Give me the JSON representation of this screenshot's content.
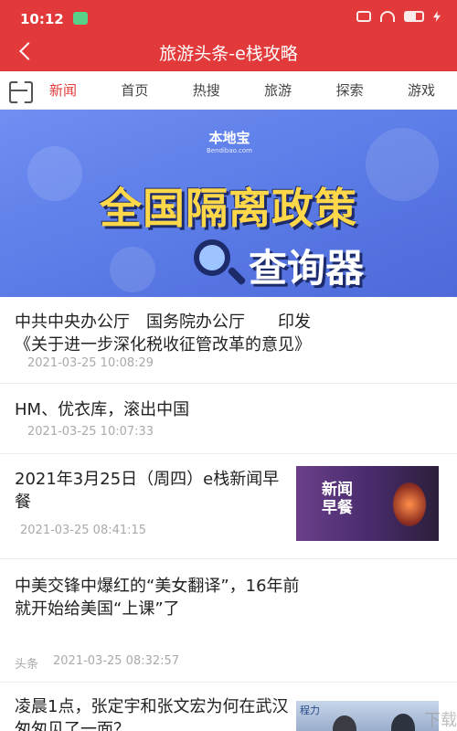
{
  "status_bar": {
    "time": "10:12"
  },
  "header": {
    "title": "旅游头条-e栈攻略"
  },
  "tabs": [
    {
      "label": "新闻",
      "active": true
    },
    {
      "label": "首页",
      "active": false
    },
    {
      "label": "热搜",
      "active": false
    },
    {
      "label": "旅游",
      "active": false
    },
    {
      "label": "探索",
      "active": false
    },
    {
      "label": "游戏",
      "active": false
    }
  ],
  "banner": {
    "brand": "本地宝",
    "brand_sub": "Bendibao.com",
    "title": "全国隔离政策",
    "subtitle": "查询器"
  },
  "news": [
    {
      "title_line1": "中共中央办公厅　国务院办公厅　　印发",
      "title_line2": "《关于进一步深化税收征管改革的意见》",
      "time": "2021-03-25 10:08:29"
    },
    {
      "title": "HM、优衣库，滚出中国",
      "time": "2021-03-25 10:07:33"
    },
    {
      "title": "2021年3月25日（周四）e栈新闻早餐",
      "time": "2021-03-25 08:41:15",
      "thumb_label_1": "新闻",
      "thumb_label_2": "早餐"
    },
    {
      "title": "中美交锋中爆红的“美女翻译”，16年前就开始给美国“上课”了",
      "source": "头条",
      "time": "2021-03-25 08:32:57"
    },
    {
      "title": "凌晨1点，张定宇和张文宏为何在武汉匆匆见了一面？",
      "thumb_text": "程力"
    }
  ],
  "watermark": "下载",
  "colors": {
    "header_red": "#e23a3a",
    "active_tab": "#e23a3a",
    "banner_blue": "#5a7ae6",
    "banner_yellow": "#ffd84a"
  }
}
